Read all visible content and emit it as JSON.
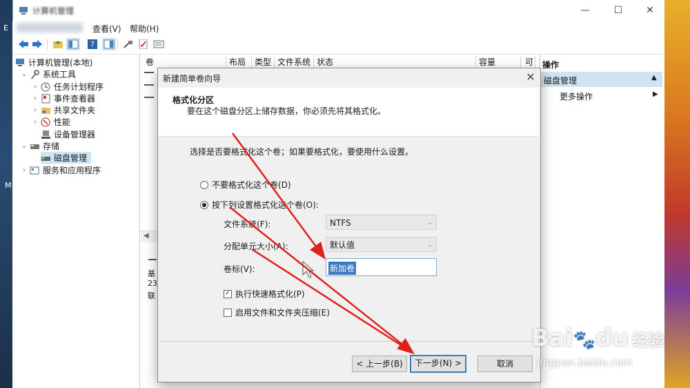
{
  "window": {
    "title": "计算机管理",
    "minimize": "—",
    "maximize": "☐",
    "close": "✕"
  },
  "menu": {
    "items": [
      "查看(V)",
      "帮助(H)"
    ]
  },
  "desktop": {
    "left_labels": [
      "E",
      "M"
    ]
  },
  "tree": {
    "root": "计算机管理(本地)",
    "system_tools": "系统工具",
    "task_scheduler": "任务计划程序",
    "event_viewer": "事件查看器",
    "shared_folders": "共享文件夹",
    "performance": "性能",
    "device_manager": "设备管理器",
    "storage": "存储",
    "disk_management": "磁盘管理",
    "services_apps": "服务和应用程序"
  },
  "center": {
    "columns": [
      "卷",
      "布局",
      "类型",
      "文件系统",
      "状态",
      "容量",
      "可"
    ],
    "disk_info": [
      "基",
      "23",
      "联"
    ]
  },
  "actions": {
    "header": "操作",
    "selected": "磁盘管理",
    "more": "更多操作"
  },
  "dialog": {
    "title": "新建简单卷向导",
    "close": "✕",
    "heading": "格式化分区",
    "subheading": "要在这个磁盘分区上储存数据，你必须先将其格式化。",
    "prompt": "选择是否要格式化这个卷；如果要格式化，要使用什么设置。",
    "option_no_format": "不要格式化这个卷(D)",
    "option_format": "按下列设置格式化这个卷(O):",
    "fs_label": "文件系统(F):",
    "fs_value": "NTFS",
    "alloc_label": "分配单元大小(A):",
    "alloc_value": "默认值",
    "vol_label": "卷标(V):",
    "vol_value": "新加卷",
    "quick_format": "执行快速格式化(P)",
    "compression": "启用文件和文件夹压缩(E)",
    "back": "< 上一步(B)",
    "next": "下一步(N) >",
    "cancel": "取消",
    "selected_option": "format",
    "quick_format_checked": true,
    "compression_checked": false
  },
  "watermark": {
    "brand": "Bai",
    "brand2": "du",
    "brand_cn": "经验",
    "url": "jingyan.baidu.com"
  },
  "colors": {
    "arrow": "#e0201c",
    "selection": "#cce4f7",
    "default_button_border": "#3c7fb1"
  }
}
